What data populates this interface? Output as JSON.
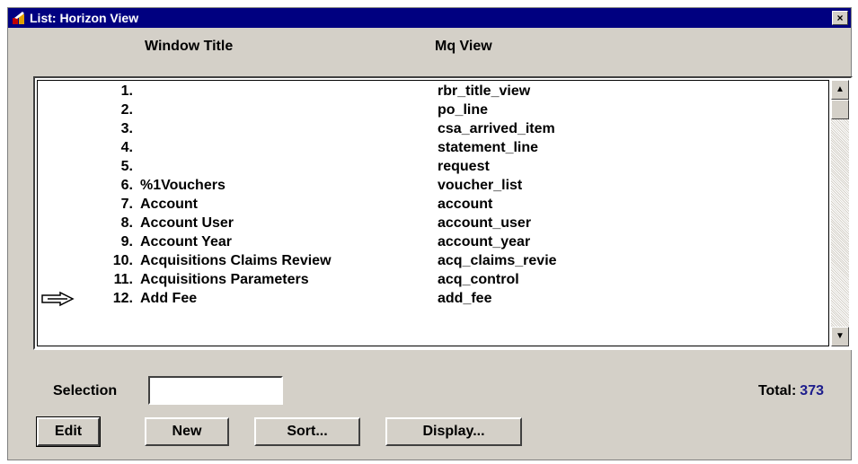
{
  "window": {
    "title": "List: Horizon View",
    "close_label": "×"
  },
  "columns": {
    "title_header": "Window Title",
    "view_header": "Mq View"
  },
  "rows": [
    {
      "num": "1.",
      "title": "",
      "view": "rbr_title_view"
    },
    {
      "num": "2.",
      "title": "",
      "view": "po_line"
    },
    {
      "num": "3.",
      "title": "",
      "view": "csa_arrived_item"
    },
    {
      "num": "4.",
      "title": "",
      "view": "statement_line"
    },
    {
      "num": "5.",
      "title": "",
      "view": "request"
    },
    {
      "num": "6.",
      "title": "%1Vouchers",
      "view": "voucher_list"
    },
    {
      "num": "7.",
      "title": "Account",
      "view": "account"
    },
    {
      "num": "8.",
      "title": "Account User",
      "view": "account_user"
    },
    {
      "num": "9.",
      "title": "Account Year",
      "view": "account_year"
    },
    {
      "num": "10.",
      "title": "Acquisitions Claims Review",
      "view": "acq_claims_revie"
    },
    {
      "num": "11.",
      "title": "Acquisitions Parameters",
      "view": "acq_control"
    },
    {
      "num": "12.",
      "title": "Add Fee",
      "view": "add_fee"
    }
  ],
  "current_row": 12,
  "selection": {
    "label": "Selection",
    "value": ""
  },
  "total": {
    "label": "Total:",
    "value": "373"
  },
  "buttons": {
    "edit": "Edit",
    "new": "New",
    "sort": "Sort...",
    "display": "Display..."
  },
  "icons": {
    "app": "horizon-app-icon",
    "pointer": "pointing-hand-icon",
    "scroll_up": "scroll-up-arrow-icon",
    "scroll_down": "scroll-down-arrow-icon"
  },
  "colors": {
    "titlebar": "#000080",
    "total_value": "#1c1c8c"
  }
}
